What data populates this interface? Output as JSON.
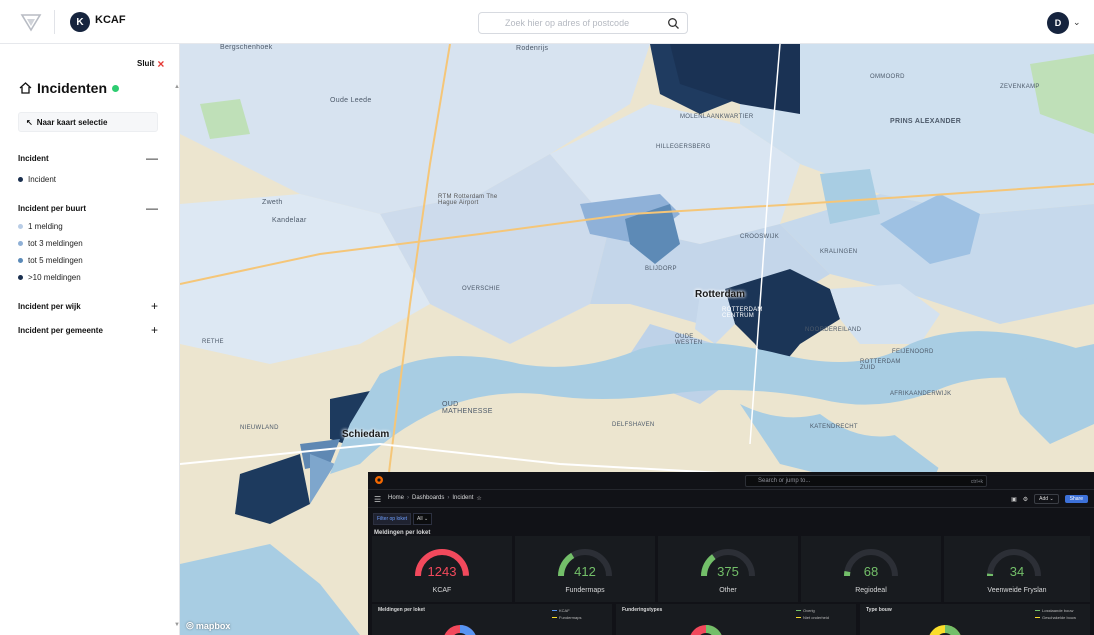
{
  "header": {
    "org_initial": "K",
    "org_name": "KCAF",
    "search_placeholder": "Zoek hier op adres of postcode",
    "user_initial": "D"
  },
  "sidebar": {
    "close_label": "Sluit",
    "title": "Incidenten",
    "back_label": "Naar kaart selectie",
    "sections": [
      {
        "title": "Incident",
        "toggle": "—",
        "items": [
          {
            "label": "Incident",
            "color": "#1a2f4e"
          }
        ]
      },
      {
        "title": "Incident per buurt",
        "toggle": "—",
        "items": [
          {
            "label": "1 melding",
            "color": "#b9cde6"
          },
          {
            "label": "tot 3 meldingen",
            "color": "#8fb0d6"
          },
          {
            "label": "tot 5 meldingen",
            "color": "#5b8ab8"
          },
          {
            "label": ">10 meldingen",
            "color": "#1a2f4e"
          }
        ]
      },
      {
        "title": "Incident per wijk",
        "toggle": "+",
        "items": []
      },
      {
        "title": "Incident per gemeente",
        "toggle": "+",
        "items": []
      }
    ]
  },
  "map": {
    "labels": {
      "oude_leede": "Oude Leede",
      "ommoord": "OMMOORD",
      "zevenkamp": "ZEVENKAMP",
      "prins_alexander": "PRINS ALEXANDER",
      "hillegersberg": "HILLEGERSBERG",
      "molenlaankwartier": "MOLENLAANKWARTIER",
      "zweth": "Zweth",
      "kandelaar": "Kandelaar",
      "rotterdam_airport": "RTM Rotterdam The Hague Airport",
      "crooswijk": "CROOSWIJK",
      "kralingen": "KRALINGEN",
      "overschie": "OVERSCHIE",
      "blijdorp": "BLIJDORP",
      "rotterdam": "Rotterdam",
      "rotterdam_centrum": "ROTTERDAM CENTRUM",
      "noordereiland": "NOORDEREILAND",
      "oude_westen": "OUDE WESTEN",
      "feijenoord": "FEIJENOORD",
      "rotterdam_zuid": "ROTTERDAM ZUID",
      "afrikaanderwijk": "AFRIKAANDERWIJK",
      "oud_mathenesse": "OUD MATHENESSE",
      "delfshaven": "DELFSHAVEN",
      "schiedam": "Schiedam",
      "nieuwland": "NIEUWLAND",
      "katendrecht": "KATENDRECHT",
      "rethe": "RETHE",
      "bergschenhoek": "Bergschenhoek",
      "rodenrijs": "Rodenrijs"
    },
    "attribution": "mapbox"
  },
  "grafana": {
    "search_placeholder": "Search or jump to...",
    "search_kbd": "ctrl+k",
    "breadcrumb": [
      "Home",
      "Dashboards",
      "Incident"
    ],
    "add_label": "Add",
    "share_label": "Share",
    "filter_label": "Filter op loket",
    "filter_value": "All",
    "row1_title": "Meldingen per loket",
    "gauges": [
      {
        "name": "KCAF",
        "value": "1243",
        "fraction": 1.0,
        "color": "#f2495c"
      },
      {
        "name": "Fundermaps",
        "value": "412",
        "fraction": 0.33,
        "color": "#73bf69"
      },
      {
        "name": "Other",
        "value": "375",
        "fraction": 0.3,
        "color": "#73bf69"
      },
      {
        "name": "Regiodeal",
        "value": "68",
        "fraction": 0.06,
        "color": "#73bf69"
      },
      {
        "name": "Veenweide Fryslan",
        "value": "34",
        "fraction": 0.03,
        "color": "#73bf69"
      }
    ],
    "bottom_panels": [
      {
        "title": "Meldingen per loket",
        "legend": []
      },
      {
        "title": "Funderingstypes",
        "legend": [
          {
            "label": "KCAF",
            "color": "#5794f2"
          },
          {
            "label": "Fundermaps",
            "color": "#fade2a"
          }
        ]
      },
      {
        "title": "Type bouw",
        "legend": [
          {
            "label": "Overig",
            "color": "#73bf69"
          },
          {
            "label": "Niet onderheid",
            "color": "#fade2a"
          }
        ]
      },
      {
        "title": "",
        "legend": [
          {
            "label": "Losstaande bouw",
            "color": "#73bf69"
          },
          {
            "label": "Geschakelde bouw",
            "color": "#fade2a"
          }
        ]
      }
    ]
  }
}
